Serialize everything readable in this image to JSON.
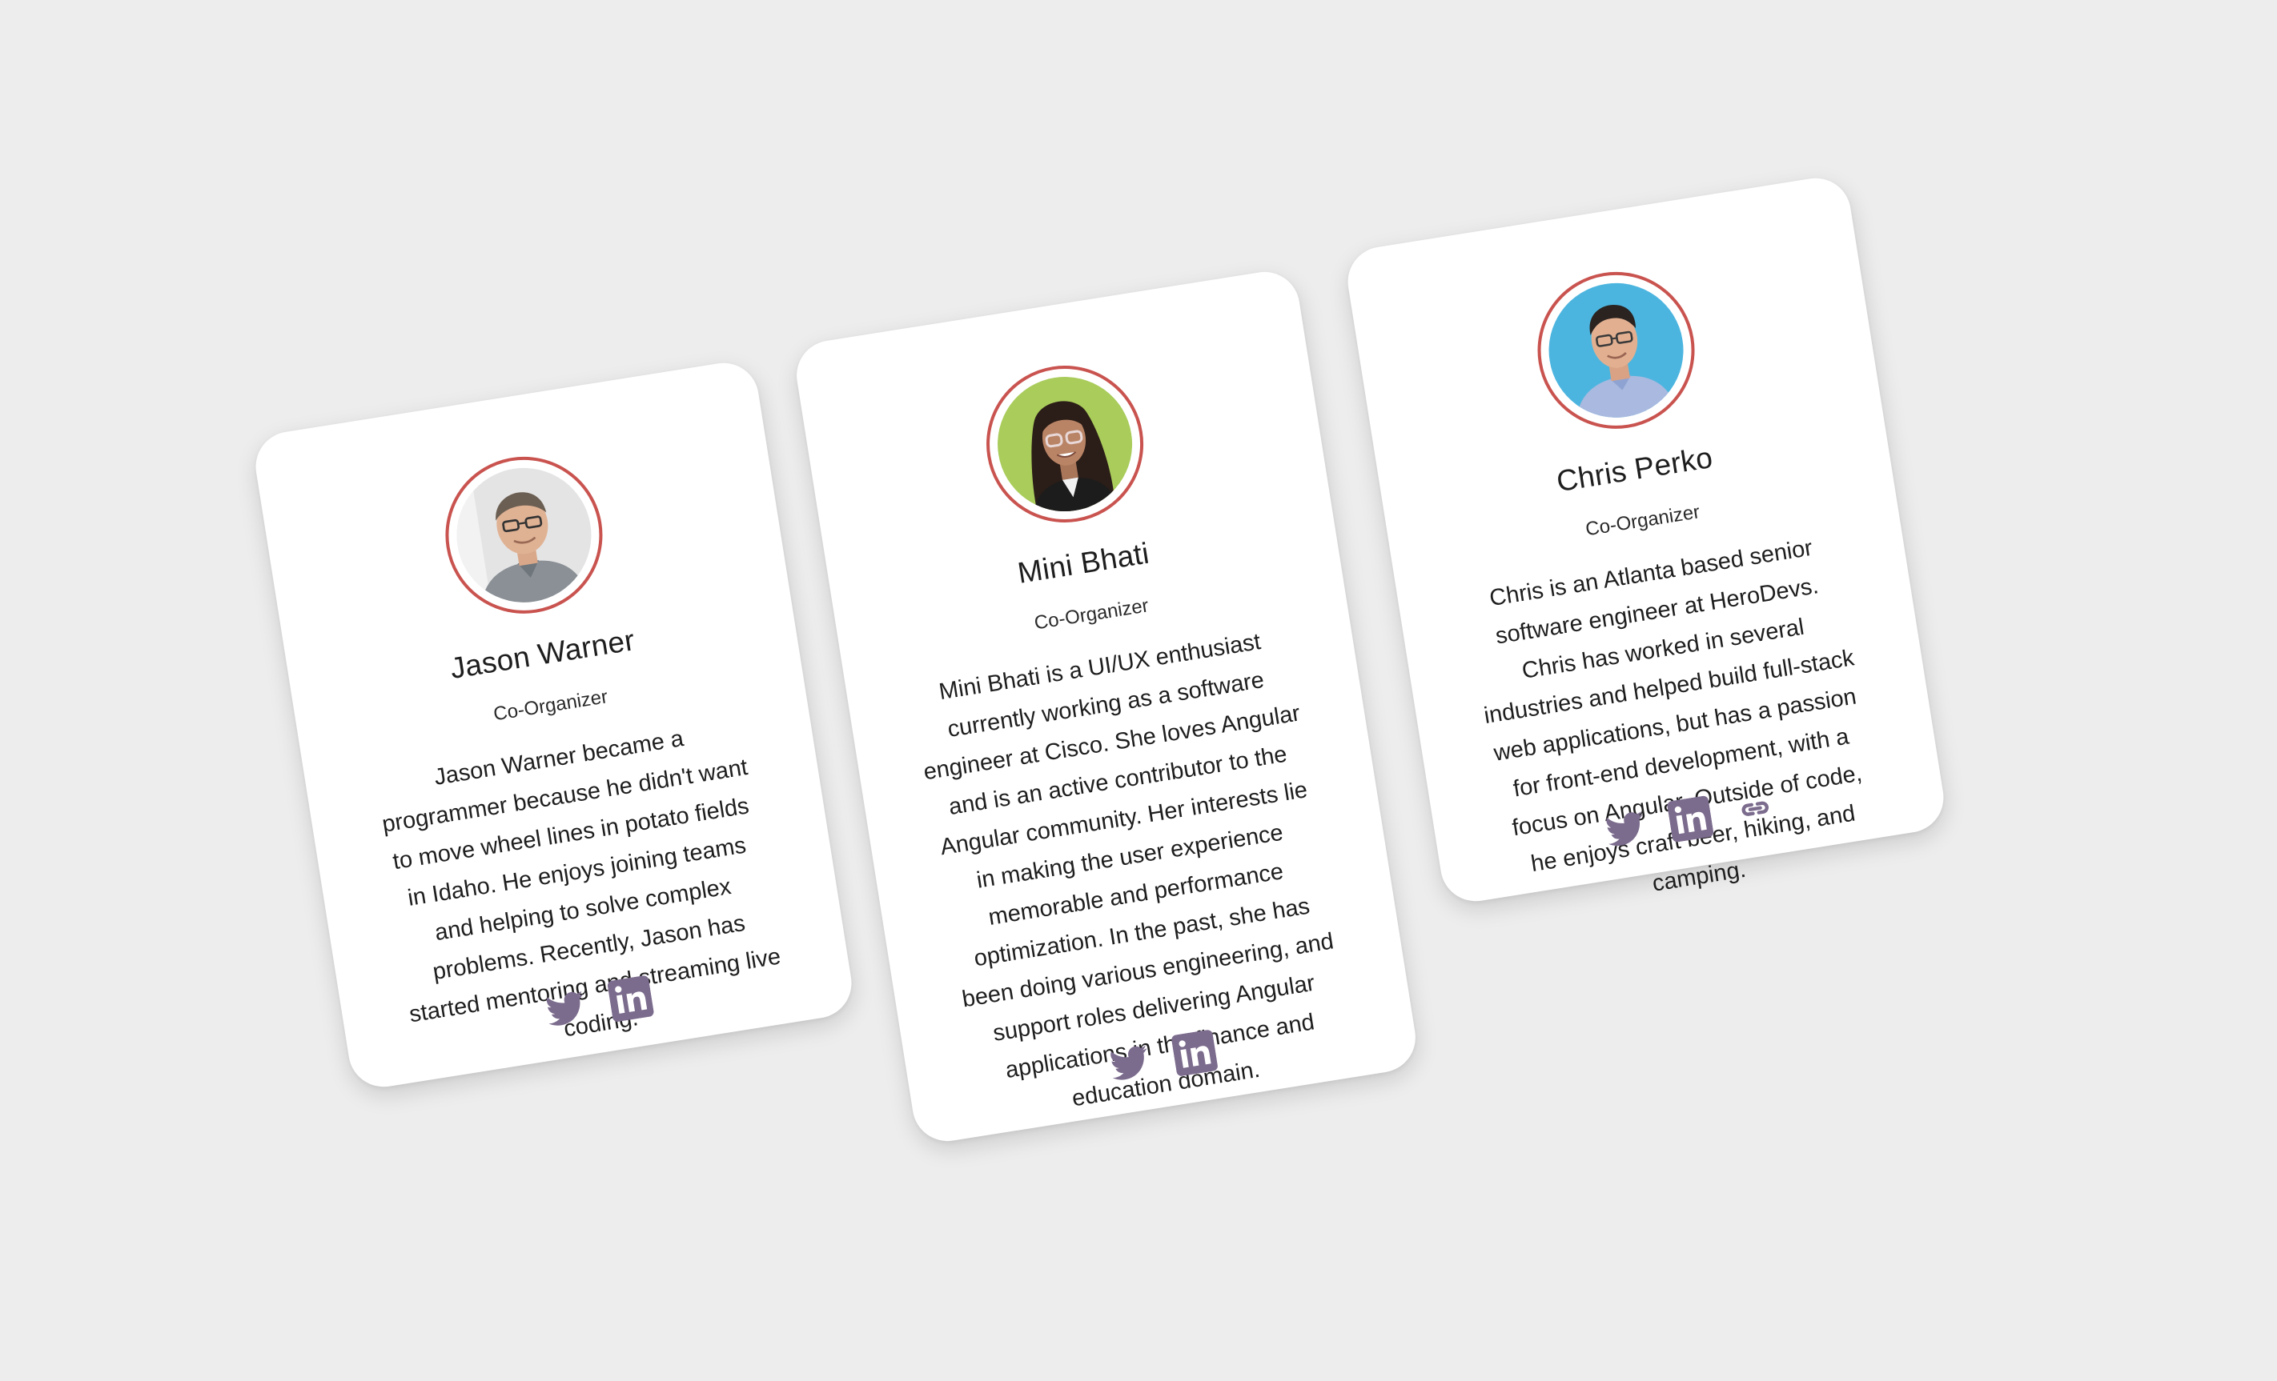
{
  "colors": {
    "background": "#ededed",
    "card": "#ffffff",
    "avatar_ring": "#c9534f",
    "icon": "#7b6b8d",
    "text": "#1e1e1e"
  },
  "organizers": [
    {
      "name": "Jason Warner",
      "role": "Co-Organizer",
      "bio": "Jason Warner became a programmer because he didn't want to move wheel lines in potato fields in Idaho. He enjoys joining teams and helping to solve complex problems. Recently, Jason has started mentoring and streaming live coding.",
      "socials": [
        "twitter-icon",
        "linkedin-icon"
      ]
    },
    {
      "name": "Mini Bhati",
      "role": "Co-Organizer",
      "bio": "Mini Bhati is a UI/UX enthusiast currently working as a software engineer at Cisco. She loves Angular and is an active contributor to the Angular community. Her interests lie in making the user experience memorable and performance optimization. In the past, she has been doing various engineering, and support roles delivering Angular applications in the finance and education domain.",
      "socials": [
        "twitter-icon",
        "linkedin-icon"
      ]
    },
    {
      "name": "Chris Perko",
      "role": "Co-Organizer",
      "bio": "Chris is an Atlanta based senior software engineer at HeroDevs. Chris has worked in several industries and helped build full-stack web applications, but has a passion for front-end development, with a focus on Angular. Outside of code, he enjoys craft beer, hiking, and camping.",
      "socials": [
        "twitter-icon",
        "linkedin-icon",
        "link-icon"
      ]
    }
  ]
}
